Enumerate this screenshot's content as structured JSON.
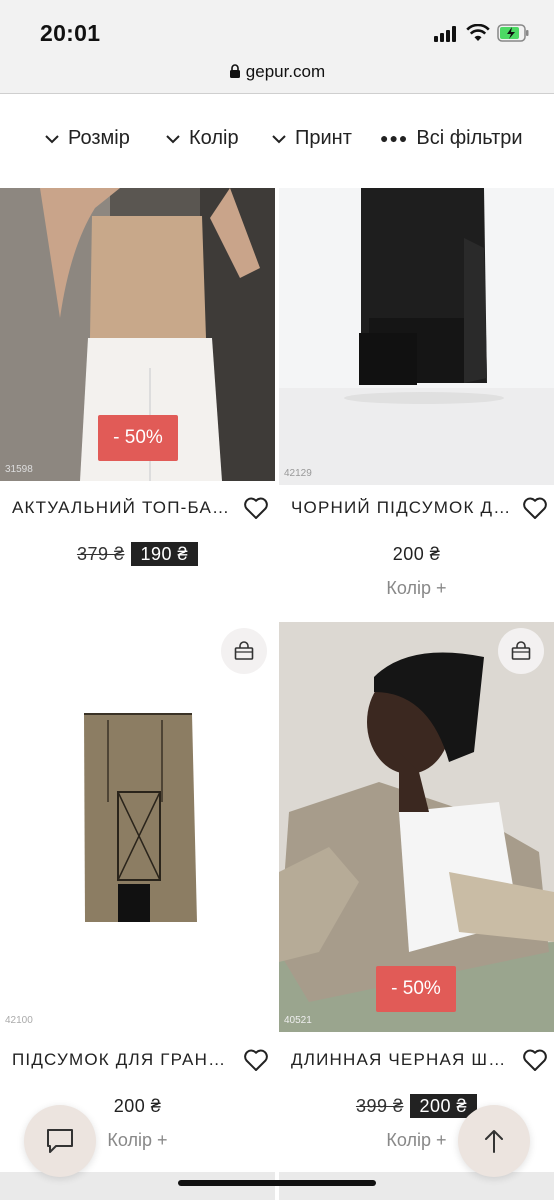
{
  "status_bar": {
    "time": "20:01"
  },
  "url_bar": {
    "domain": "gepur.com"
  },
  "filters": [
    {
      "label": "Розмір"
    },
    {
      "label": "Колір"
    },
    {
      "label": "Принт"
    },
    {
      "label": "Всі фільтри"
    }
  ],
  "products": [
    {
      "sku": "31598",
      "title": "АКТУАЛЬНИЙ ТОП-БАНДО",
      "old_price": "379 ₴",
      "price": "190 ₴",
      "discount": "- 50%"
    },
    {
      "sku": "42129",
      "title": "ЧОРНИЙ ПІДСУМОК ДЛЯ",
      "price": "200 ₴",
      "color_more": "Колір +"
    },
    {
      "sku": "42100",
      "title": "ПІДСУМОК ДЛЯ ГРАНАТИ",
      "price": "200 ₴",
      "color_more": "Колір +"
    },
    {
      "sku": "40521",
      "title": "ДЛИННАЯ ЧЕРНАЯ ШАПКА",
      "old_price": "399 ₴",
      "price": "200 ₴",
      "discount": "- 50%",
      "color_more": "Колір +"
    }
  ],
  "colors": {
    "discount_badge": "#e15b57",
    "fab_bg": "#ece4df",
    "price_tag_bg": "#222222"
  },
  "icons": [
    "lock-icon",
    "chevron-down-icon",
    "dots-icon",
    "heart-icon",
    "shopping-bag-icon",
    "chat-icon",
    "arrow-up-icon"
  ]
}
